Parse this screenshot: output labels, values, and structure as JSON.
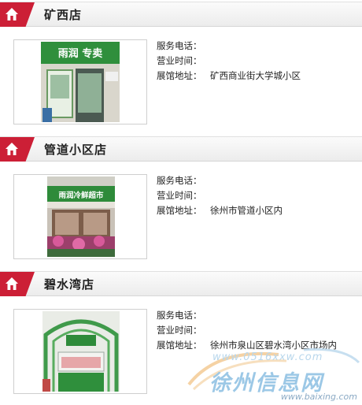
{
  "labels": {
    "phone": "服务电话：",
    "hours": "营业时间：",
    "address": "展馆地址："
  },
  "stores": [
    {
      "name": "矿西店",
      "phone": "",
      "hours": "",
      "address": "矿西商业街大学城小区",
      "sign_text": "雨润 专卖"
    },
    {
      "name": "管道小区店",
      "phone": "",
      "hours": "",
      "address": "徐州市管道小区内",
      "sign_text": "雨润冷鲜超市"
    },
    {
      "name": "碧水湾店",
      "phone": "",
      "hours": "",
      "address": "徐州市泉山区碧水湾小区市场内",
      "sign_text": ""
    }
  ],
  "watermark": {
    "url": "www.0516xxw.com",
    "title": "徐州信息网",
    "sub": "www.baixing.com"
  },
  "colors": {
    "accent": "#cc1f36",
    "header_bg": "#f2f2f2",
    "brand_green": "#2e8b3a"
  }
}
